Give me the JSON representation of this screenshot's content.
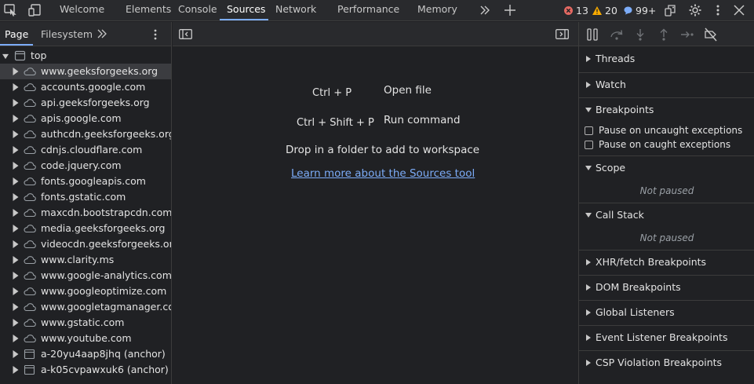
{
  "toolbar": {
    "tabs": [
      "Welcome",
      "Elements",
      "Console",
      "Sources",
      "Network",
      "Performance",
      "Memory"
    ],
    "active_tab": "Sources",
    "errors": "13",
    "warnings": "20",
    "messages": "99+"
  },
  "navigator": {
    "tabs": [
      "Page",
      "Filesystem"
    ],
    "root": "top",
    "items": [
      {
        "label": "www.geeksforgeeks.org",
        "type": "cloud",
        "selected": true
      },
      {
        "label": "accounts.google.com",
        "type": "cloud"
      },
      {
        "label": "api.geeksforgeeks.org",
        "type": "cloud"
      },
      {
        "label": "apis.google.com",
        "type": "cloud"
      },
      {
        "label": "authcdn.geeksforgeeks.org",
        "type": "cloud"
      },
      {
        "label": "cdnjs.cloudflare.com",
        "type": "cloud"
      },
      {
        "label": "code.jquery.com",
        "type": "cloud"
      },
      {
        "label": "fonts.googleapis.com",
        "type": "cloud"
      },
      {
        "label": "fonts.gstatic.com",
        "type": "cloud"
      },
      {
        "label": "maxcdn.bootstrapcdn.com",
        "type": "cloud"
      },
      {
        "label": "media.geeksforgeeks.org",
        "type": "cloud"
      },
      {
        "label": "videocdn.geeksforgeeks.org",
        "type": "cloud"
      },
      {
        "label": "www.clarity.ms",
        "type": "cloud"
      },
      {
        "label": "www.google-analytics.com",
        "type": "cloud"
      },
      {
        "label": "www.googleoptimize.com",
        "type": "cloud"
      },
      {
        "label": "www.googletagmanager.com",
        "type": "cloud"
      },
      {
        "label": "www.gstatic.com",
        "type": "cloud"
      },
      {
        "label": "www.youtube.com",
        "type": "cloud"
      },
      {
        "label": "a-20yu4aap8jhq (anchor)",
        "type": "frame"
      },
      {
        "label": "a-k05cvpawxuk6 (anchor)",
        "type": "frame"
      }
    ]
  },
  "editor": {
    "shortcut_open": "Ctrl + P",
    "label_open": "Open file",
    "shortcut_run": "Ctrl + Shift + P",
    "label_run": "Run command",
    "drop_hint": "Drop in a folder to add to workspace",
    "learn_more": "Learn more about the Sources tool"
  },
  "debugger": {
    "threads": "Threads",
    "watch": "Watch",
    "breakpoints": "Breakpoints",
    "pause_uncaught": "Pause on uncaught exceptions",
    "pause_caught": "Pause on caught exceptions",
    "scope": "Scope",
    "scope_status": "Not paused",
    "call_stack": "Call Stack",
    "call_stack_status": "Not paused",
    "xhr": "XHR/fetch Breakpoints",
    "dom": "DOM Breakpoints",
    "global": "Global Listeners",
    "event": "Event Listener Breakpoints",
    "csp": "CSP Violation Breakpoints"
  },
  "colors": {
    "accent": "#7cacf8",
    "error": "#e46962",
    "warning": "#f9ab00",
    "info": "#7cacf8"
  }
}
